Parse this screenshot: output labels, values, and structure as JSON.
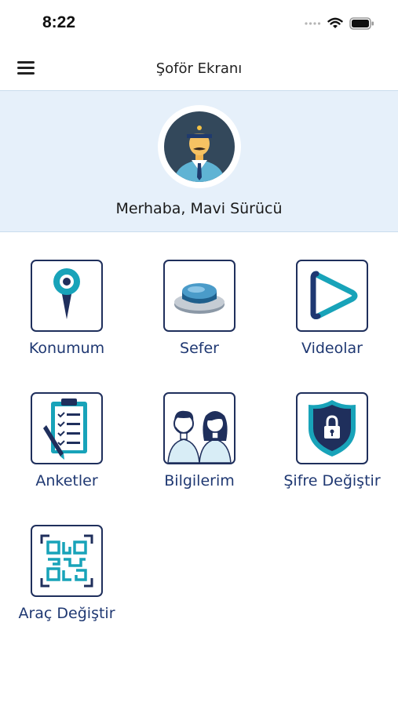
{
  "status_bar": {
    "time": "8:22"
  },
  "nav": {
    "title": "Şoför Ekranı",
    "menu_icon": "hamburger-menu-icon"
  },
  "header": {
    "greeting": "Merhaba, Mavi Sürücü",
    "avatar_icon": "driver-avatar-icon"
  },
  "tiles": [
    {
      "label": "Konumum",
      "icon": "location-pin-icon"
    },
    {
      "label": "Sefer",
      "icon": "push-button-icon"
    },
    {
      "label": "Videolar",
      "icon": "play-icon"
    },
    {
      "label": "Anketler",
      "icon": "clipboard-checklist-icon"
    },
    {
      "label": "Bilgilerim",
      "icon": "people-icon"
    },
    {
      "label": "Şifre Değiştir",
      "icon": "lock-shield-icon"
    },
    {
      "label": "Araç Değiştir",
      "icon": "qr-code-icon"
    }
  ],
  "colors": {
    "label": "#1f3872",
    "tile_border": "#1f2f5c",
    "header_bg": "#e6f0fa",
    "accent_teal": "#18a3b9"
  }
}
